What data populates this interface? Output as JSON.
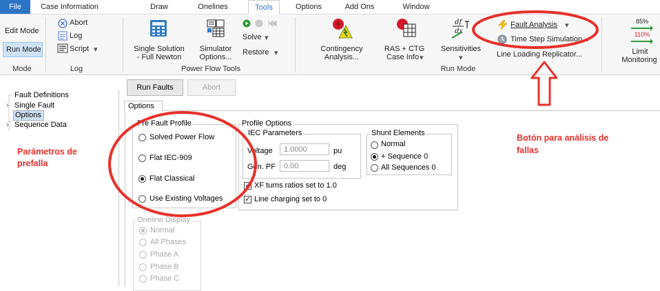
{
  "tabs": [
    "File",
    "Case Information",
    "Draw",
    "Onelines",
    "Tools",
    "Options",
    "Add Ons",
    "Window"
  ],
  "ribbon": {
    "mode": {
      "edit": "Edit Mode",
      "run": "Run Mode",
      "group": "Mode"
    },
    "log": {
      "abort": "Abort",
      "log": "Log",
      "script": "Script",
      "group": "Log"
    },
    "pft": {
      "single_solution_1": "Single Solution",
      "single_solution_2": "- Full Newton",
      "simulator_1": "Simulator",
      "simulator_2": "Options...",
      "solve": "Solve",
      "restore": "Restore",
      "group": "Power Flow Tools"
    },
    "run": {
      "contingency_1": "Contingency",
      "contingency_2": "Analysis...",
      "rasctg_1": "RAS + CTG",
      "rasctg_2": "Case Info",
      "sensitivities": "Sensitivities",
      "fault_analysis": "Fault Analysis",
      "time_step": "Time Step Simulation...",
      "line_loading": "Line Loading Replicator...",
      "group": "Run Mode",
      "limit_1": "Limit",
      "limit_2": "Monitoring",
      "limit_pct_1": "85%",
      "limit_pct_2": "110%"
    }
  },
  "tree": {
    "items": [
      "Fault Definitions",
      "Single Fault",
      "Options",
      "Sequence Data"
    ]
  },
  "annotations": {
    "left_1": "Parámetros de",
    "left_2": "prefalla",
    "right_1": "Botón para análisis de",
    "right_2": "fallas"
  },
  "main": {
    "run_faults": "Run Faults",
    "abort": "Abort",
    "options_tab": "Options",
    "pre_fault_profile": "Pre Fault Profile",
    "pre_fault_options": [
      "Solved Power Flow",
      "Flat IEC-909",
      "Flat Classical",
      "Use Existing Voltages"
    ],
    "profile_options": "Profile Options",
    "iec_parameters": "IEC Parameters",
    "voltage_label": "Voltage",
    "voltage_value": "1.0000",
    "voltage_unit": "pu",
    "genpf_label": "Gen. PF",
    "genpf_value": "0.00",
    "genpf_unit": "deg",
    "shunt_elements": "Shunt Elements",
    "shunt_options": [
      "Normal",
      "+ Sequence 0",
      "All Sequences 0"
    ],
    "xf_turns": "XF turns ratios set to 1.0",
    "line_charging": "Line charging set to 0",
    "oneline_display": "Oneline Display",
    "oneline_options": [
      "Normal",
      "All Phases",
      "Phase A",
      "Phase B",
      "Phase C"
    ]
  },
  "colors": {
    "accent": "#2b74c6",
    "annotation_red": "#e8312a"
  }
}
